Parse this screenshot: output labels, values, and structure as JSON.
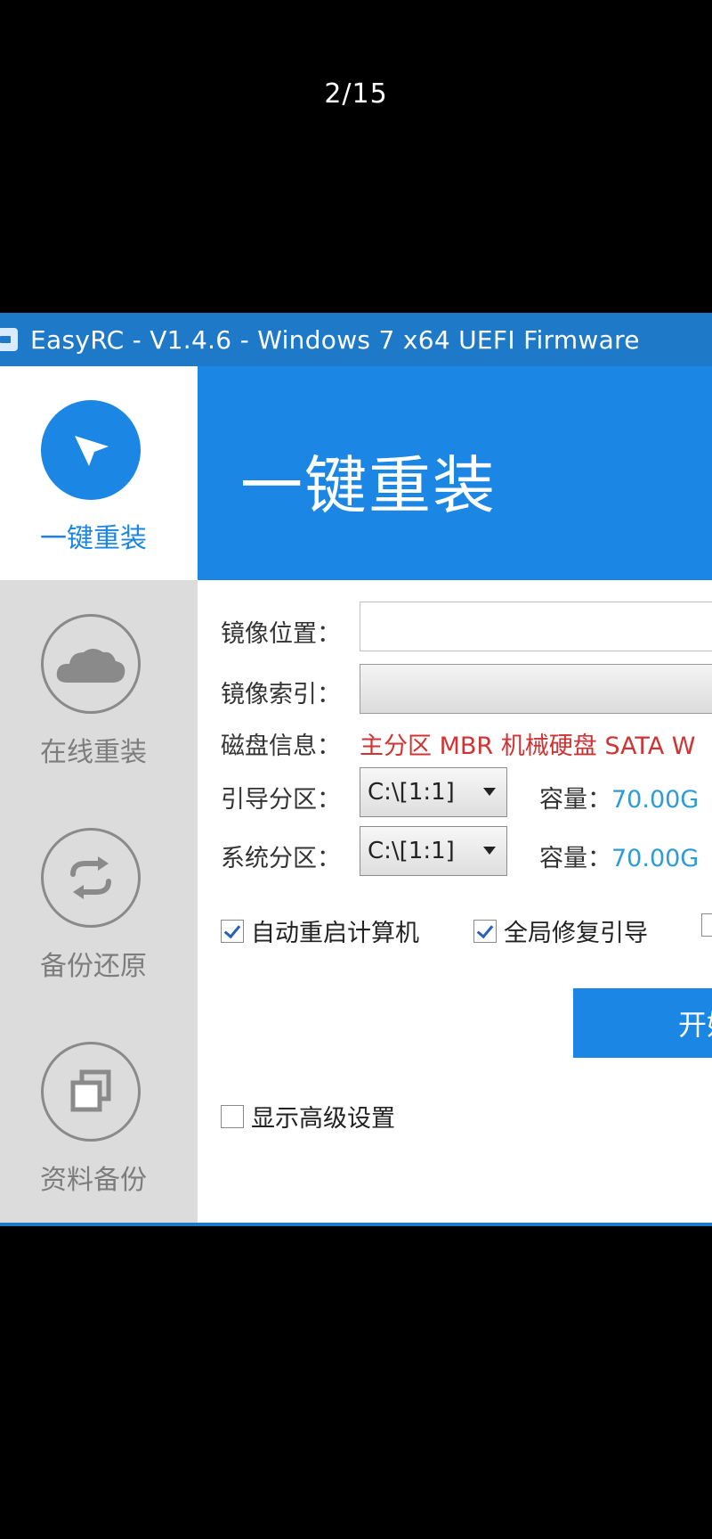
{
  "page_counter": "2/15",
  "window": {
    "title": "EasyRC - V1.4.6 - Windows 7 x64 UEFI Firmware"
  },
  "sidebar": {
    "items": [
      {
        "label": "一键重装",
        "icon": "cursor-arrow-icon",
        "active": true
      },
      {
        "label": "在线重装",
        "icon": "cloud-icon",
        "active": false
      },
      {
        "label": "备份还原",
        "icon": "sync-arrows-icon",
        "active": false
      },
      {
        "label": "资料备份",
        "icon": "copy-squares-icon",
        "active": false
      }
    ]
  },
  "banner": {
    "title": "一键重装"
  },
  "form": {
    "image_location_label": "镜像位置：",
    "image_location_value": "",
    "image_index_label": "镜像索引：",
    "image_index_value": "",
    "disk_info_label": "磁盘信息：",
    "disk_info_value": "主分区 MBR 机械硬盘 SATA W",
    "boot_partition_label": "引导分区：",
    "boot_partition_value": "C:\\[1:1]",
    "boot_capacity_label": "容量：",
    "boot_capacity_value": "70.00G",
    "system_partition_label": "系统分区：",
    "system_partition_value": "C:\\[1:1]",
    "system_capacity_label": "容量：",
    "system_capacity_value": "70.00G"
  },
  "options": {
    "auto_restart": {
      "label": "自动重启计算机",
      "checked": true
    },
    "global_repair_boot": {
      "label": "全局修复引导",
      "checked": true
    },
    "show_advanced": {
      "label": "显示高级设置",
      "checked": false
    }
  },
  "actions": {
    "start_label": "开始"
  },
  "colors": {
    "accent": "#1b86e3",
    "titlebar": "#1f79c9",
    "disk_info": "#d23232",
    "capacity": "#2e9bd6"
  }
}
